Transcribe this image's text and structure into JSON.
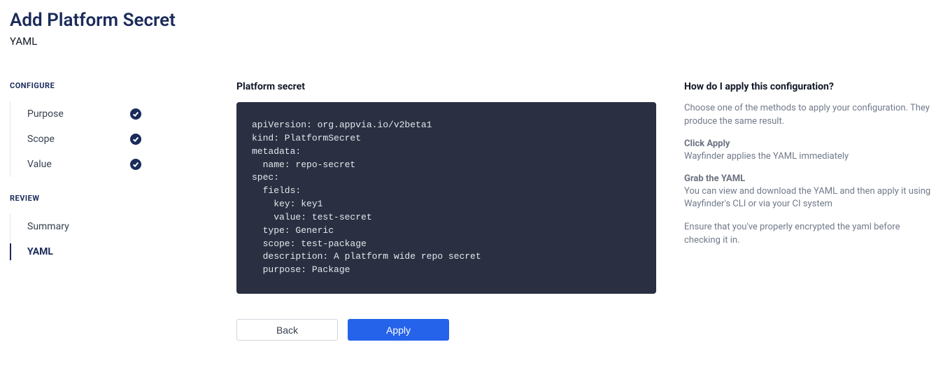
{
  "header": {
    "title": "Add Platform Secret",
    "subtitle": "YAML"
  },
  "sidebar": {
    "configure_label": "CONFIGURE",
    "review_label": "REVIEW",
    "configure_items": [
      {
        "label": "Purpose",
        "done": true
      },
      {
        "label": "Scope",
        "done": true
      },
      {
        "label": "Value",
        "done": true
      }
    ],
    "review_items": [
      {
        "label": "Summary",
        "active": false
      },
      {
        "label": "YAML",
        "active": true
      }
    ]
  },
  "main": {
    "label": "Platform secret",
    "yaml": "apiVersion: org.appvia.io/v2beta1\nkind: PlatformSecret\nmetadata:\n  name: repo-secret\nspec:\n  fields:\n    key: key1\n    value: test-secret\n  type: Generic\n  scope: test-package\n  description: A platform wide repo secret\n  purpose: Package",
    "back_label": "Back",
    "apply_label": "Apply"
  },
  "help": {
    "title": "How do I apply this configuration?",
    "intro": "Choose one of the methods to apply your configuration. They produce the same result.",
    "click_apply_label": "Click Apply",
    "click_apply_text": "Wayfinder applies the YAML immediately",
    "grab_yaml_label": "Grab the YAML",
    "grab_yaml_text": "You can view and download the YAML and then apply it using Wayfinder's CLI or via your CI system",
    "encrypt_text": "Ensure that you've properly encrypted the yaml before checking it in."
  }
}
